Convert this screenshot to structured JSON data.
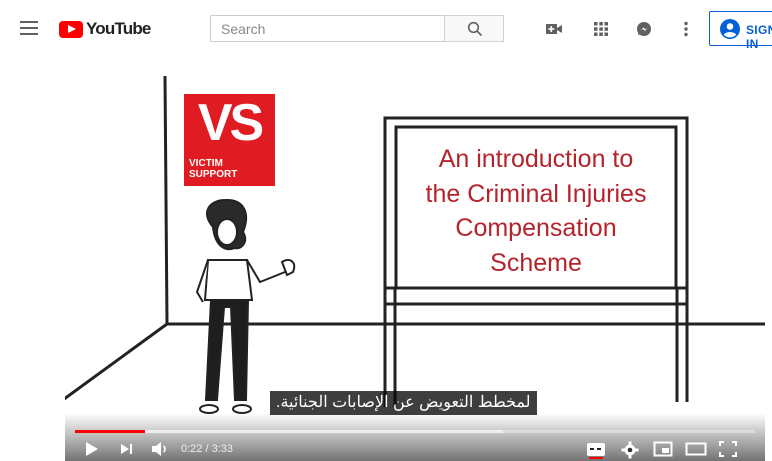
{
  "header": {
    "logo_text": "YouTube",
    "search_placeholder": "Search",
    "signin_label": "SIGN IN",
    "icons": [
      "menu-icon",
      "youtube-logo",
      "search-icon",
      "create-video-icon",
      "apps-grid-icon",
      "messages-icon",
      "more-vert-icon",
      "account-circle-icon"
    ]
  },
  "video": {
    "logo_letters": "VS",
    "logo_line1": "VICTIM",
    "logo_line2": "SUPPORT",
    "board_lines": [
      "An introduction to",
      "the Criminal Injuries",
      "Compensation",
      "Scheme"
    ],
    "caption": "لمخطط التعويض عن الإصابات الجنائية.",
    "time_current": "0:22",
    "time_separator": "/",
    "time_total": "3:33",
    "progress_fraction": 0.103,
    "buffer_fraction": 0.63,
    "captions_on": true,
    "icons": [
      "play-icon",
      "next-icon",
      "volume-icon",
      "subtitles-icon",
      "settings-icon",
      "miniplayer-icon",
      "theater-mode-icon",
      "fullscreen-icon"
    ]
  },
  "colors": {
    "brand_red": "#ff0000",
    "logo_red": "#e11b22",
    "board_text": "#b5232d",
    "signin_blue": "#065fd4"
  }
}
